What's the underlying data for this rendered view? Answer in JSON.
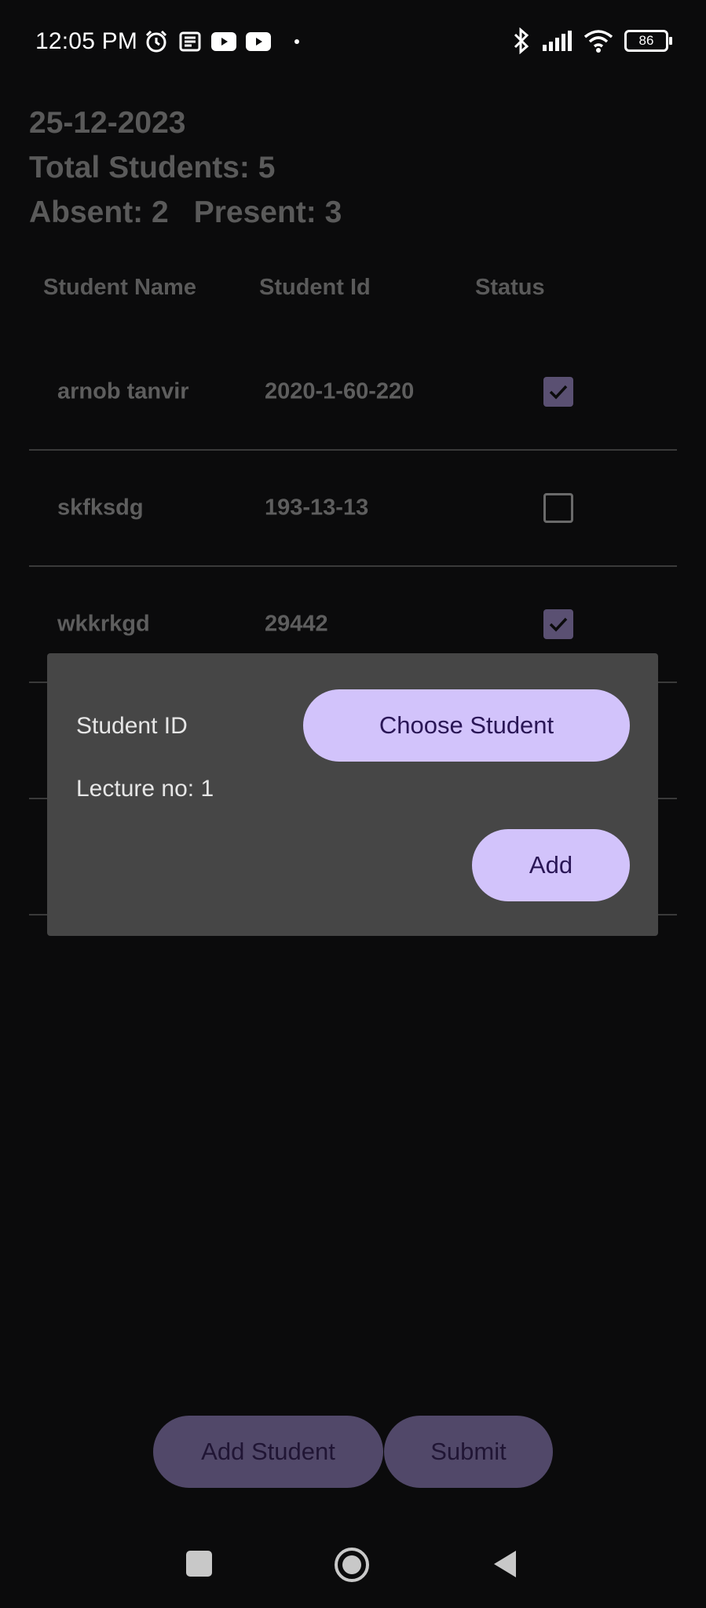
{
  "status_bar": {
    "time": "12:05 PM",
    "icons_left": [
      "alarm-icon",
      "news-icon",
      "youtube-icon",
      "youtube-icon",
      "dot-icon"
    ],
    "icons_right": [
      "bluetooth-icon",
      "signal-icon",
      "wifi-icon",
      "battery-icon"
    ],
    "battery": "86"
  },
  "header": {
    "date": "25-12-2023",
    "total": "Total Students: 5",
    "absent": "Absent: 2",
    "present": "Present: 3"
  },
  "table": {
    "columns": [
      "Student Name",
      "Student Id",
      "Status"
    ],
    "rows": [
      {
        "name": "arnob tanvir",
        "id": "2020-1-60-220",
        "checked": true
      },
      {
        "name": "skfksdg",
        "id": "193-13-13",
        "checked": false
      },
      {
        "name": "wkkrkgd",
        "id": "29442",
        "checked": true
      }
    ]
  },
  "dialog": {
    "student_id_label": "Student ID",
    "choose_button": "Choose Student",
    "lecture_label": "Lecture no: 1",
    "add_button": "Add"
  },
  "actions": {
    "add_student": "Add Student",
    "submit": "Submit"
  },
  "colors": {
    "background": "#0b0b0c",
    "dialog": "#464646",
    "accent": "#d2c3fb",
    "accent_dim": "#514869"
  }
}
